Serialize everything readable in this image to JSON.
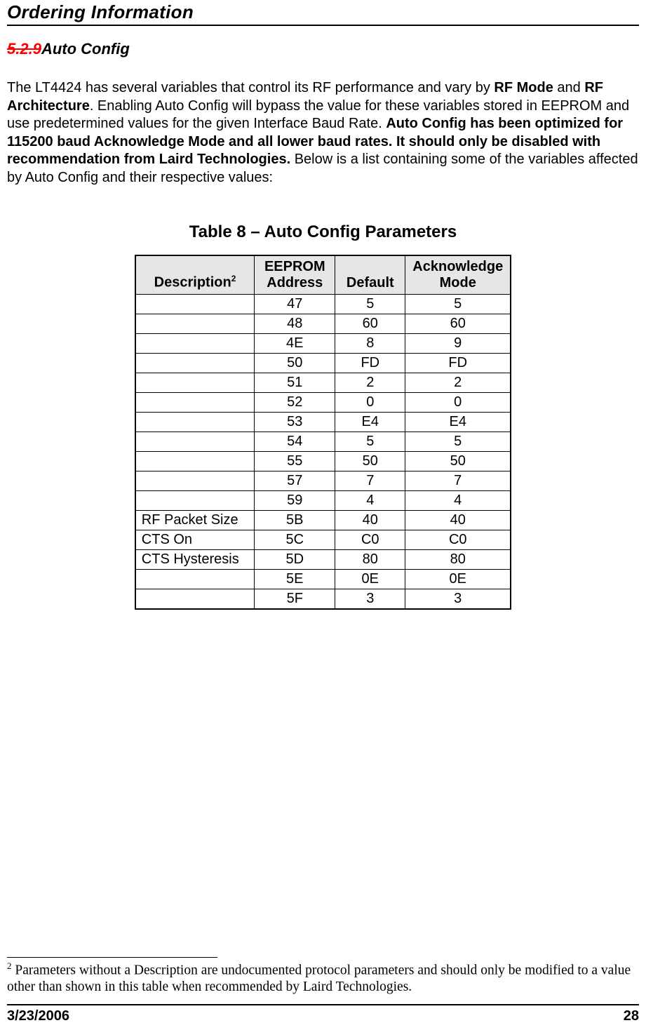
{
  "header": {
    "title": "Ordering Information"
  },
  "section": {
    "num": "5.2.9",
    "name": "Auto Config"
  },
  "para": {
    "p1": "The LT4424 has several variables that control its RF performance and vary by ",
    "b1": "RF Mode",
    "p2": " and ",
    "b2": "RF Architecture",
    "p3": ". Enabling Auto Config will bypass the value for these variables stored in EEPROM and use predetermined values for the given Interface Baud Rate.  ",
    "b3": "Auto Config has been optimized for 115200 baud Acknowledge Mode and all lower baud rates.  It should only be disabled with recommendation from Laird Technologies.",
    "p4": "  Below is a list containing some of the variables affected by Auto Config and their respective values:"
  },
  "table": {
    "title": "Table 8 – Auto Config Parameters",
    "headers": {
      "desc": "Description",
      "desc_sup": "2",
      "addr": "EEPROM Address",
      "def": "Default",
      "ack": "Acknowledge Mode"
    },
    "rows": [
      {
        "desc": "",
        "addr": "47",
        "def": "5",
        "ack": "5"
      },
      {
        "desc": "",
        "addr": "48",
        "def": "60",
        "ack": "60"
      },
      {
        "desc": "",
        "addr": "4E",
        "def": "8",
        "ack": "9"
      },
      {
        "desc": "",
        "addr": "50",
        "def": "FD",
        "ack": "FD"
      },
      {
        "desc": "",
        "addr": "51",
        "def": "2",
        "ack": "2"
      },
      {
        "desc": "",
        "addr": "52",
        "def": "0",
        "ack": "0"
      },
      {
        "desc": "",
        "addr": "53",
        "def": "E4",
        "ack": "E4"
      },
      {
        "desc": "",
        "addr": "54",
        "def": "5",
        "ack": "5"
      },
      {
        "desc": "",
        "addr": "55",
        "def": "50",
        "ack": "50"
      },
      {
        "desc": "",
        "addr": "57",
        "def": "7",
        "ack": "7"
      },
      {
        "desc": "",
        "addr": "59",
        "def": "4",
        "ack": "4"
      },
      {
        "desc": "RF Packet Size",
        "addr": "5B",
        "def": "40",
        "ack": "40"
      },
      {
        "desc": "CTS On",
        "addr": "5C",
        "def": "C0",
        "ack": "C0"
      },
      {
        "desc": "CTS Hysteresis",
        "addr": "5D",
        "def": "80",
        "ack": "80"
      },
      {
        "desc": "",
        "addr": "5E",
        "def": "0E",
        "ack": "0E"
      },
      {
        "desc": "",
        "addr": "5F",
        "def": "3",
        "ack": "3"
      }
    ]
  },
  "footnote": {
    "sup": "2",
    "text": " Parameters without a Description are undocumented protocol parameters and should only be modified to a value other than shown in this table when recommended by Laird Technologies."
  },
  "footer": {
    "date": "3/23/2006",
    "page": "28"
  }
}
